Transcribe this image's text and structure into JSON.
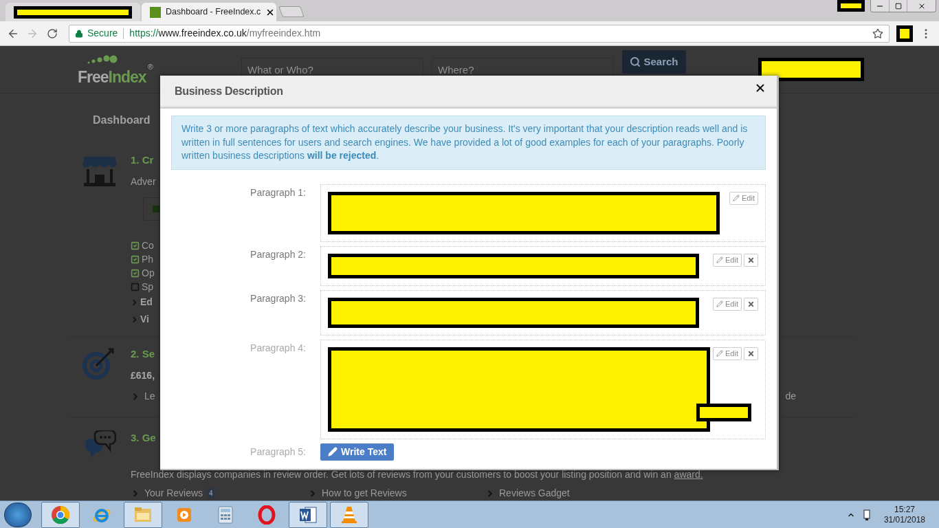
{
  "browser": {
    "tabs": [
      {
        "kind": "redacted",
        "selected": false
      },
      {
        "kind": "page",
        "title": "Dashboard - FreeIndex.c",
        "selected": true
      }
    ],
    "forward_disabled": true,
    "secure_label": "Secure",
    "url_scheme": "https://",
    "url_host": "www.freeindex.co.uk",
    "url_path": "/myfreeindex.htm"
  },
  "page": {
    "logo_first": "Free",
    "logo_second": "Index",
    "logo_mark": "®",
    "what_placeholder": "What or Who?",
    "where_placeholder": "Where?",
    "search_button": "Search",
    "nav_tab": "Dashboard",
    "section_1": {
      "heading": "1. Cr",
      "text": "Adver",
      "checklist": [
        {
          "label": "Co",
          "checked": true
        },
        {
          "label": "Ph",
          "checked": true
        },
        {
          "label": "Op",
          "checked": true
        },
        {
          "label": "Sp",
          "checked": false
        }
      ],
      "links": [
        "Ed",
        "Vi"
      ]
    },
    "section_2": {
      "heading": "2. Se",
      "text": "£616,",
      "link": "Le",
      "trailing": "de"
    },
    "section_3": {
      "heading": "3. Ge",
      "text": "FreeIndex displays companies in review order. Get lots of reviews from your customers to boost your listing position and win an",
      "text_link": "award.",
      "links": [
        {
          "label": "Your Reviews",
          "badge": "4"
        },
        {
          "label": "How to get Reviews"
        },
        {
          "label": "Reviews Gadget"
        }
      ]
    }
  },
  "modal": {
    "title": "Business Description",
    "notice": "Write 3 or more paragraphs of text which accurately describe your business. It's very important that your description reads well and is written in full sentences for users and search engines. We have provided a lot of good examples for each of your paragraphs. Poorly written business descriptions **will be rejected**.",
    "rows": [
      {
        "label": "Paragraph 1:",
        "kind": "text",
        "muted": false,
        "edit": "Edit",
        "deletable": false
      },
      {
        "label": "Paragraph 2:",
        "kind": "text",
        "muted": false,
        "edit": "Edit",
        "deletable": true
      },
      {
        "label": "Paragraph 3:",
        "kind": "text",
        "muted": false,
        "edit": "Edit",
        "deletable": true
      },
      {
        "label": "Paragraph 4:",
        "kind": "text",
        "muted": true,
        "edit": "Edit",
        "deletable": true
      },
      {
        "label": "Paragraph 5:",
        "kind": "empty",
        "muted": true,
        "button": "Write Text"
      }
    ]
  },
  "taskbar": {
    "apps": [
      {
        "kind": "chrome",
        "open": true
      },
      {
        "kind": "ie",
        "open": false
      },
      {
        "kind": "explorer",
        "open": true
      },
      {
        "kind": "media",
        "open": false
      },
      {
        "kind": "calculator",
        "open": false
      },
      {
        "kind": "opera",
        "open": false
      },
      {
        "kind": "word",
        "open": true
      },
      {
        "kind": "vlc",
        "open": true
      }
    ],
    "time": "15:27",
    "date": "31/01/2018"
  }
}
